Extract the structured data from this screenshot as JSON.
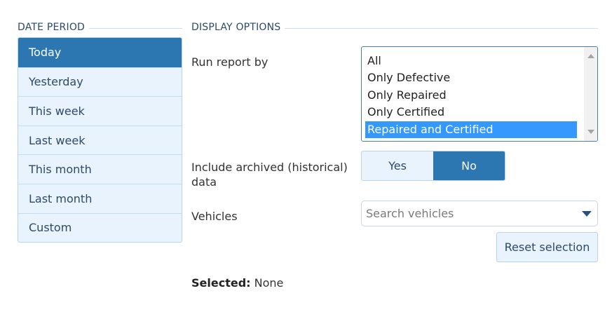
{
  "date_period": {
    "heading": "DATE PERIOD",
    "items": [
      {
        "label": "Today",
        "active": true
      },
      {
        "label": "Yesterday",
        "active": false
      },
      {
        "label": "This week",
        "active": false
      },
      {
        "label": "Last week",
        "active": false
      },
      {
        "label": "This month",
        "active": false
      },
      {
        "label": "Last month",
        "active": false
      },
      {
        "label": "Custom",
        "active": false
      }
    ]
  },
  "display_options": {
    "heading": "DISPLAY OPTIONS",
    "run_report_by": {
      "label": "Run report by",
      "options": [
        "All",
        "Only Defective",
        "Only Repaired",
        "Only Certified",
        "Repaired and Certified"
      ],
      "selected": "Repaired and Certified"
    },
    "archived": {
      "label": "Include archived (historical) data",
      "yes_label": "Yes",
      "no_label": "No",
      "value": "No"
    },
    "vehicles": {
      "label": "Vehicles",
      "placeholder": "Search vehicles"
    },
    "reset_label": "Reset selection",
    "selected_prefix": "Selected:",
    "selected_value": "None"
  },
  "colors": {
    "accent": "#2c76b1",
    "selected_option": "#3399ff",
    "button_bg": "#e8f3fd"
  }
}
